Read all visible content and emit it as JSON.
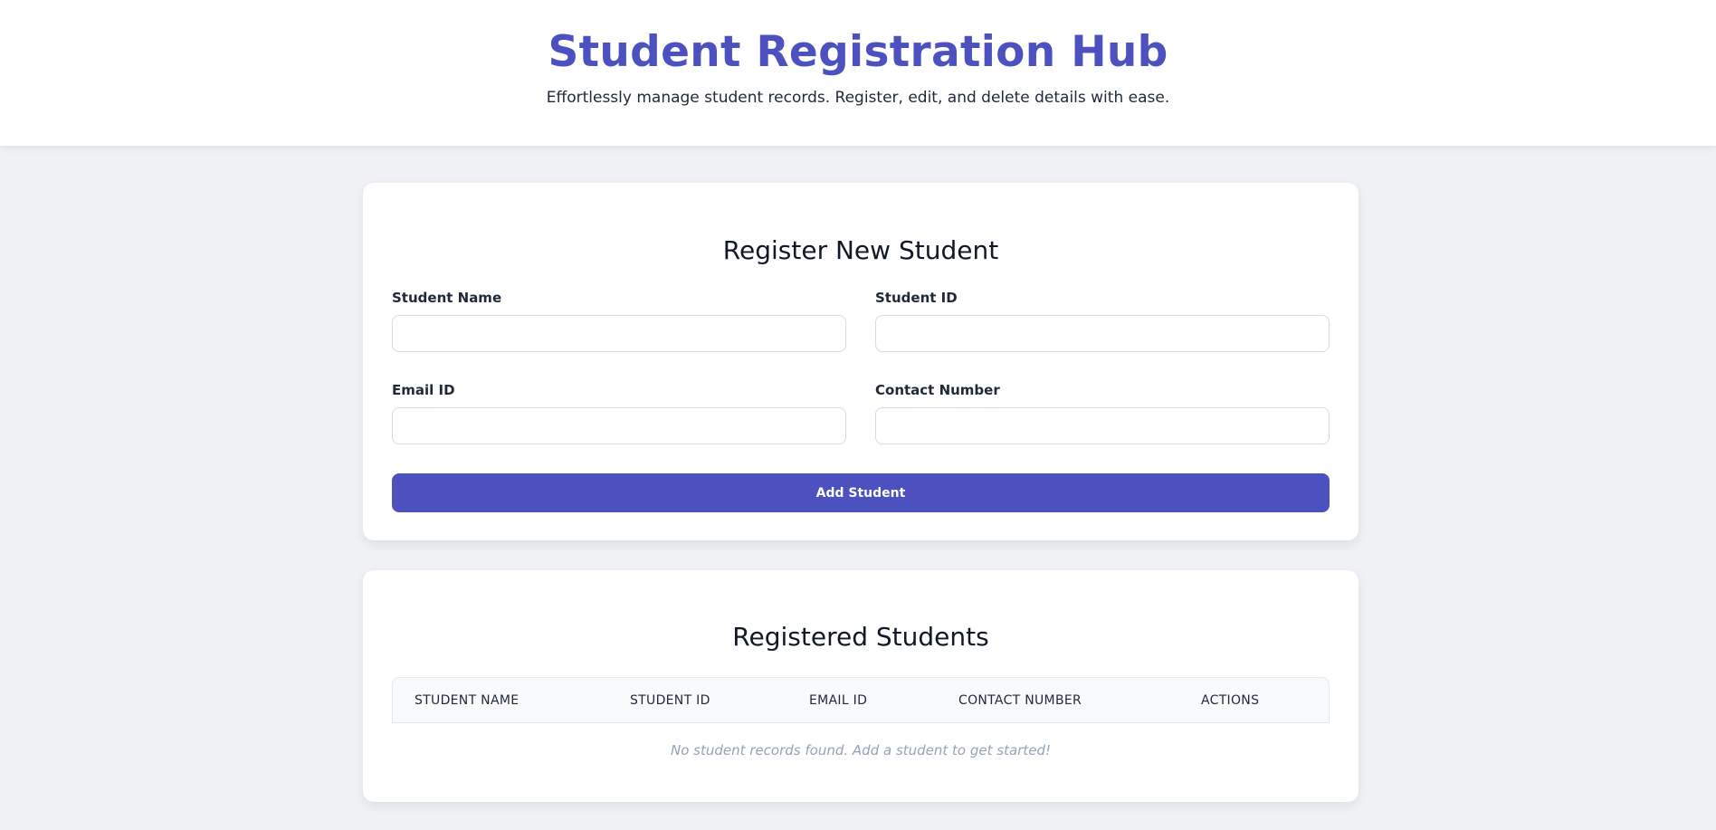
{
  "header": {
    "title": "Student Registration Hub",
    "subtitle": "Effortlessly manage student records. Register, edit, and delete details with ease."
  },
  "form": {
    "title": "Register New Student",
    "fields": {
      "student_name": {
        "label": "Student Name",
        "value": ""
      },
      "student_id": {
        "label": "Student ID",
        "value": ""
      },
      "email_id": {
        "label": "Email ID",
        "value": ""
      },
      "contact_number": {
        "label": "Contact Number",
        "value": ""
      }
    },
    "submit_label": "Add Student"
  },
  "students": {
    "title": "Registered Students",
    "columns": [
      "STUDENT NAME",
      "STUDENT ID",
      "EMAIL ID",
      "CONTACT NUMBER",
      "ACTIONS"
    ],
    "rows": [],
    "empty_message": "No student records found. Add a student to get started!"
  },
  "colors": {
    "accent": "#4c51bf",
    "background": "#eff1f5",
    "card": "#ffffff",
    "muted_text": "#94a3b8"
  }
}
